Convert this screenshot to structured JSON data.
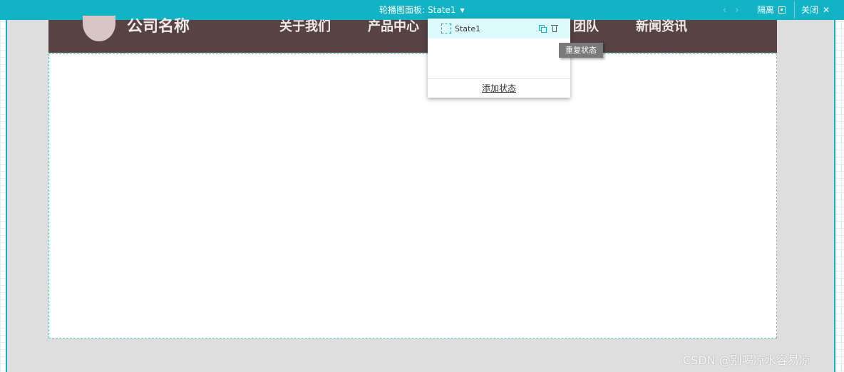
{
  "topbar": {
    "panel_label": "轮播图面板:",
    "current_state": "State1",
    "prev_arrow": "‹",
    "next_arrow": "›",
    "isolate_label": "隔离",
    "close_label": "关闭",
    "close_glyph": "✕",
    "color": "#12b3c4"
  },
  "canvas": {
    "company_name": "公司名称",
    "nav": [
      "关于我们",
      "产品中心",
      "团队",
      "新闻资讯"
    ],
    "header_color": "#574343"
  },
  "state_dropdown": {
    "states": [
      {
        "label": "State1",
        "selected": true
      }
    ],
    "add_state_label": "添加状态"
  },
  "tooltip": {
    "text": "重复状态"
  },
  "watermark": "CSDN @别喝凉水容易凉"
}
